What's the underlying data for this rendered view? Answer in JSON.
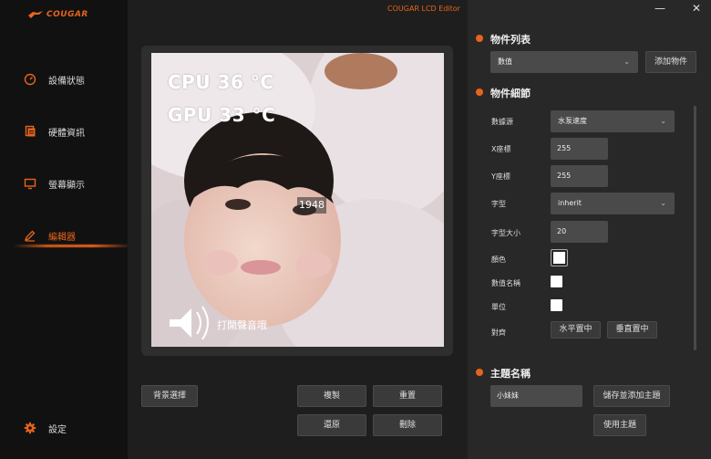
{
  "app": {
    "title": "COUGAR LCD Editor",
    "logo_text": "COUGAR"
  },
  "window": {
    "minimize": "—",
    "close": "✕"
  },
  "sidebar": {
    "items": [
      {
        "label": "設備狀態",
        "icon": "gauge-icon"
      },
      {
        "label": "硬體資訊",
        "icon": "document-icon"
      },
      {
        "label": "螢幕顯示",
        "icon": "monitor-icon"
      },
      {
        "label": "編輯器",
        "icon": "pencil-icon",
        "active": true
      }
    ],
    "settings_label": "設定"
  },
  "preview": {
    "cpu_text": "CPU 36 °C",
    "gpu_text": "GPU 33 °C",
    "number_text": "1948",
    "caption": "打開聲音哦"
  },
  "buttons": {
    "background_select": "背景選擇",
    "copy": "複製",
    "reset": "重置",
    "restore": "還原",
    "delete": "刪除"
  },
  "object_list": {
    "title": "物件列表",
    "selected": "數值",
    "add_button": "添加物件"
  },
  "object_details": {
    "title": "物件細節",
    "data_source_label": "數據源",
    "data_source_value": "水泵速度",
    "x_label": "X座標",
    "x_value": "255",
    "y_label": "Y座標",
    "y_value": "255",
    "font_label": "字型",
    "font_value": "inherit",
    "font_size_label": "字型大小",
    "font_size_value": "20",
    "color_label": "顏色",
    "value_name_label": "數值名稱",
    "unit_label": "單位",
    "align_label": "對齊",
    "align_h": "水平置中",
    "align_v": "垂直置中"
  },
  "theme": {
    "title": "主題名稱",
    "name_value": "小妹妹",
    "save_add": "儲存並添加主題",
    "use": "使用主題"
  },
  "colors": {
    "accent": "#e8641b",
    "panel": "#282828",
    "sidebar": "#111111"
  }
}
